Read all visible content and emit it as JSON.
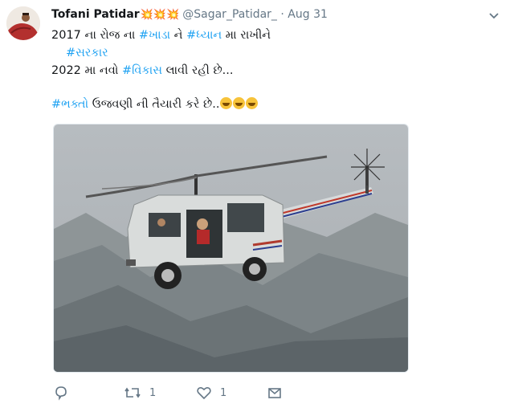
{
  "author": {
    "name": "Tofani Patidar",
    "badges": "💥💥💥",
    "handle": "@Sagar_Patidar_",
    "separator": "·",
    "date": "Aug 31"
  },
  "tweet_text": {
    "l1_a": "2017 ના રોજ ના ",
    "l1_tag1": "#ખાડા",
    "l1_b": " ને ",
    "l1_tag2": "#ધ્યાન",
    "l1_c": " મા રાખીને",
    "l2_tag": "#સરકાર",
    "l3_a": "2022 મા નવો ",
    "l3_tag": "#વિકાસ",
    "l3_b": " લાવી રહી છે...",
    "l4_tag": "#ભક્તો",
    "l4_a": " ઉજવણી ની તૈયારી કરે છે.."
  },
  "emojis": [
    "grinning-face",
    "grinning-face",
    "grinning-face"
  ],
  "actions": {
    "reply_count": "",
    "retweet_count": "1",
    "like_count": "1"
  },
  "colors": {
    "link": "#1da1f2",
    "muted": "#657786",
    "text": "#14171a"
  }
}
